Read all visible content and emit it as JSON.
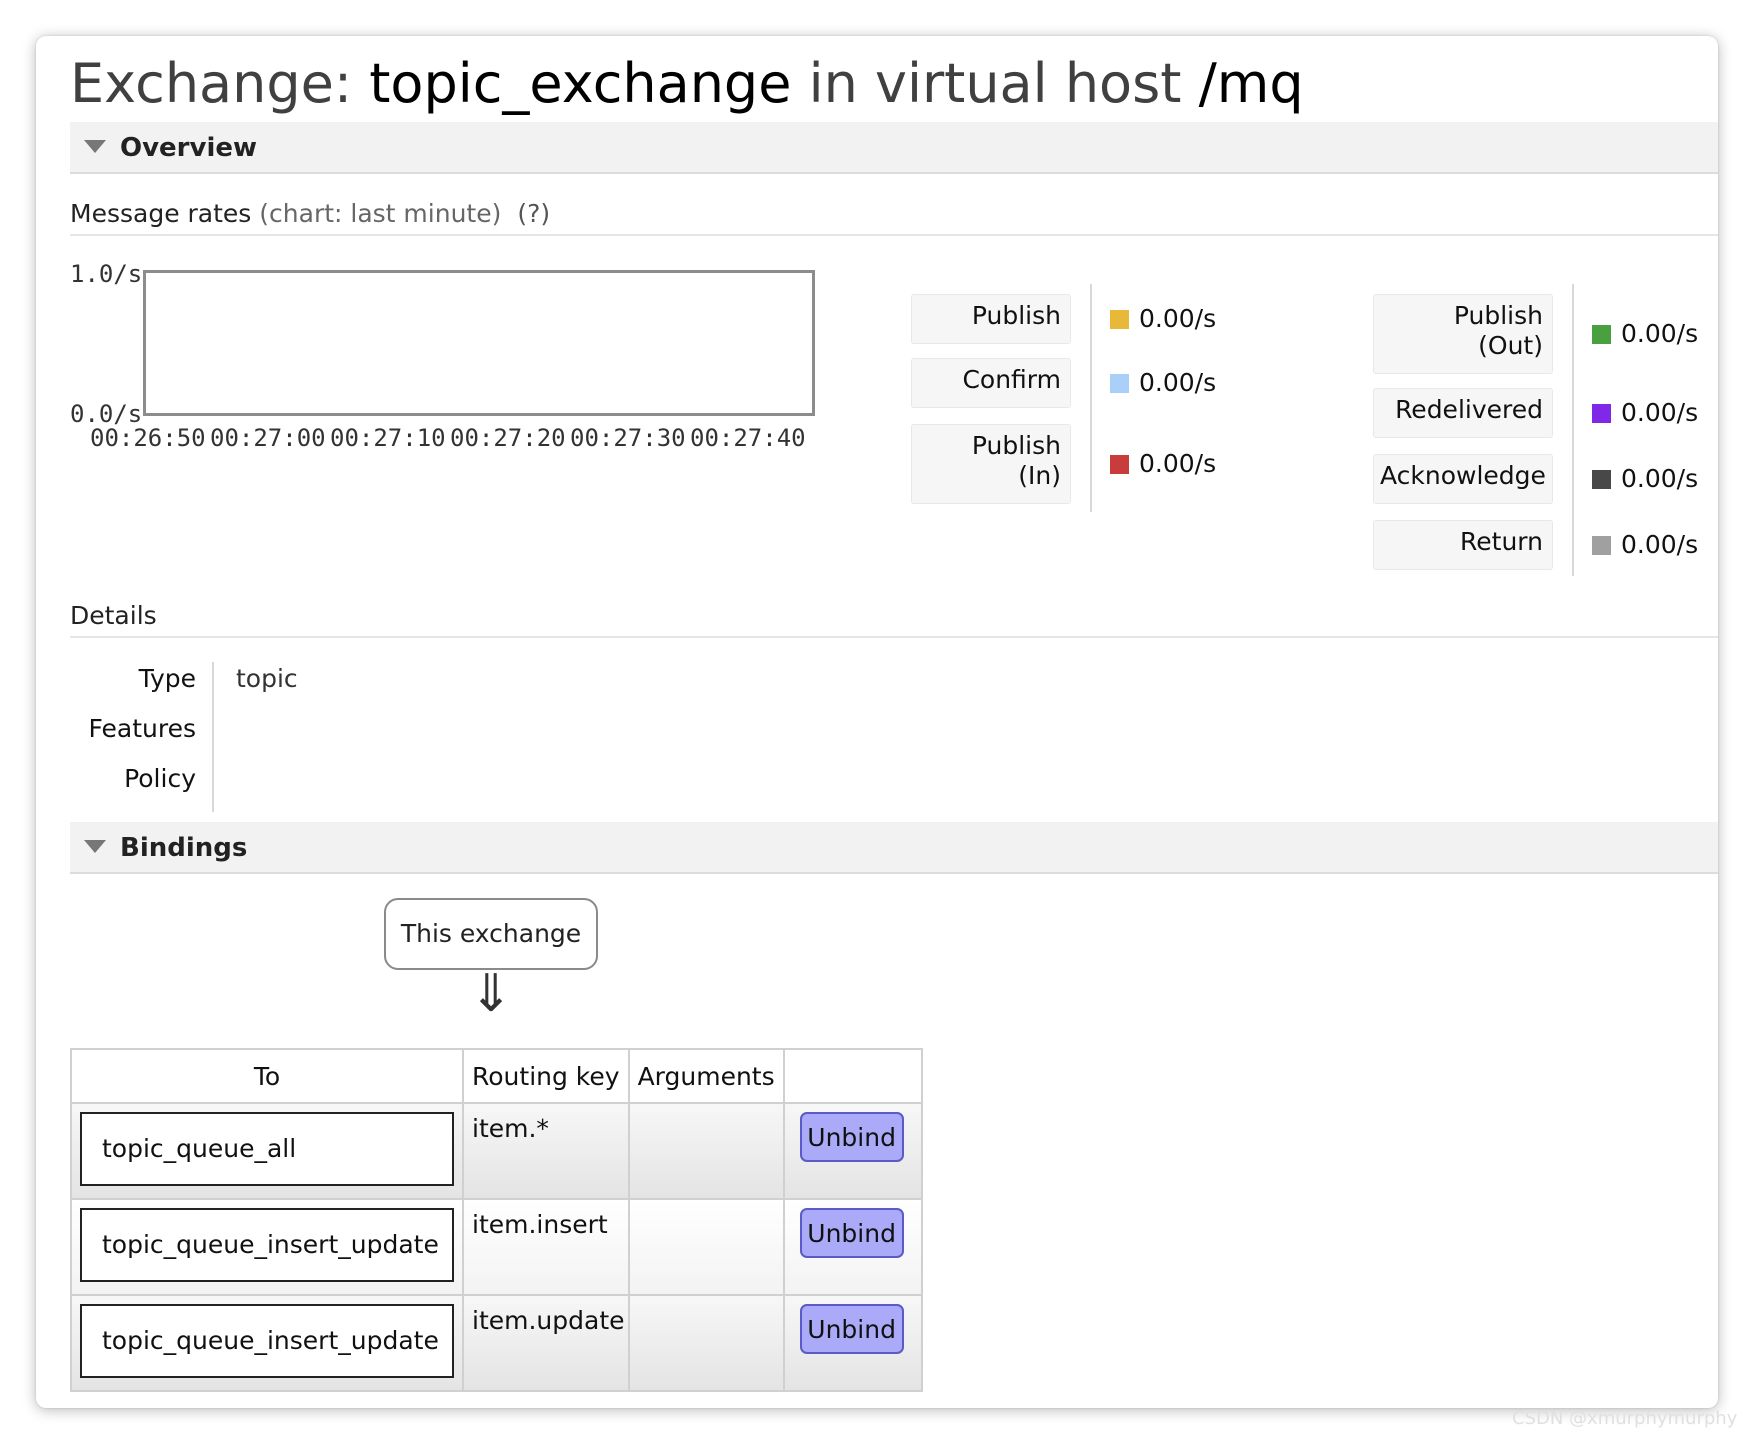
{
  "page": {
    "title_prefix": "Exchange:",
    "exchange_name": "topic_exchange",
    "title_middle": "in virtual host",
    "vhost": "/mq"
  },
  "overview": {
    "label": "Overview",
    "rates_label": "Message rates",
    "rates_hint": "(chart: last minute)",
    "rates_help": "(?)",
    "chart": {
      "y_max_label": "1.0/s",
      "y_min_label": "0.0/s",
      "x_ticks": [
        "00:26:50",
        "00:27:00",
        "00:27:10",
        "00:27:20",
        "00:27:30",
        "00:27:40"
      ]
    },
    "legend_left": [
      {
        "label": "Publish",
        "value": "0.00/s",
        "color": "#e8b838"
      },
      {
        "label": "Confirm",
        "value": "0.00/s",
        "color": "#a8d0f8"
      },
      {
        "label": "Publish\n(In)",
        "value": "0.00/s",
        "color": "#c83c3c"
      }
    ],
    "legend_right": [
      {
        "label": "Publish\n(Out)",
        "value": "0.00/s",
        "color": "#48a040"
      },
      {
        "label": "Redelivered",
        "value": "0.00/s",
        "color": "#8028e8"
      },
      {
        "label": "Acknowledge",
        "value": "0.00/s",
        "color": "#484848"
      },
      {
        "label": "Return",
        "value": "0.00/s",
        "color": "#a0a0a0"
      }
    ]
  },
  "details": {
    "label": "Details",
    "rows": [
      {
        "key": "Type",
        "value": "topic"
      },
      {
        "key": "Features",
        "value": ""
      },
      {
        "key": "Policy",
        "value": ""
      }
    ]
  },
  "bindings": {
    "label": "Bindings",
    "this_exchange": "This exchange",
    "arrow": "⇓",
    "columns": [
      "To",
      "Routing key",
      "Arguments",
      ""
    ],
    "rows": [
      {
        "to": "topic_queue_all",
        "routing_key": "item.*",
        "arguments": "",
        "action": "Unbind"
      },
      {
        "to": "topic_queue_insert_update",
        "routing_key": "item.insert",
        "arguments": "",
        "action": "Unbind"
      },
      {
        "to": "topic_queue_insert_update",
        "routing_key": "item.update",
        "arguments": "",
        "action": "Unbind"
      }
    ]
  },
  "watermark": "CSDN @xmurphymurphy"
}
